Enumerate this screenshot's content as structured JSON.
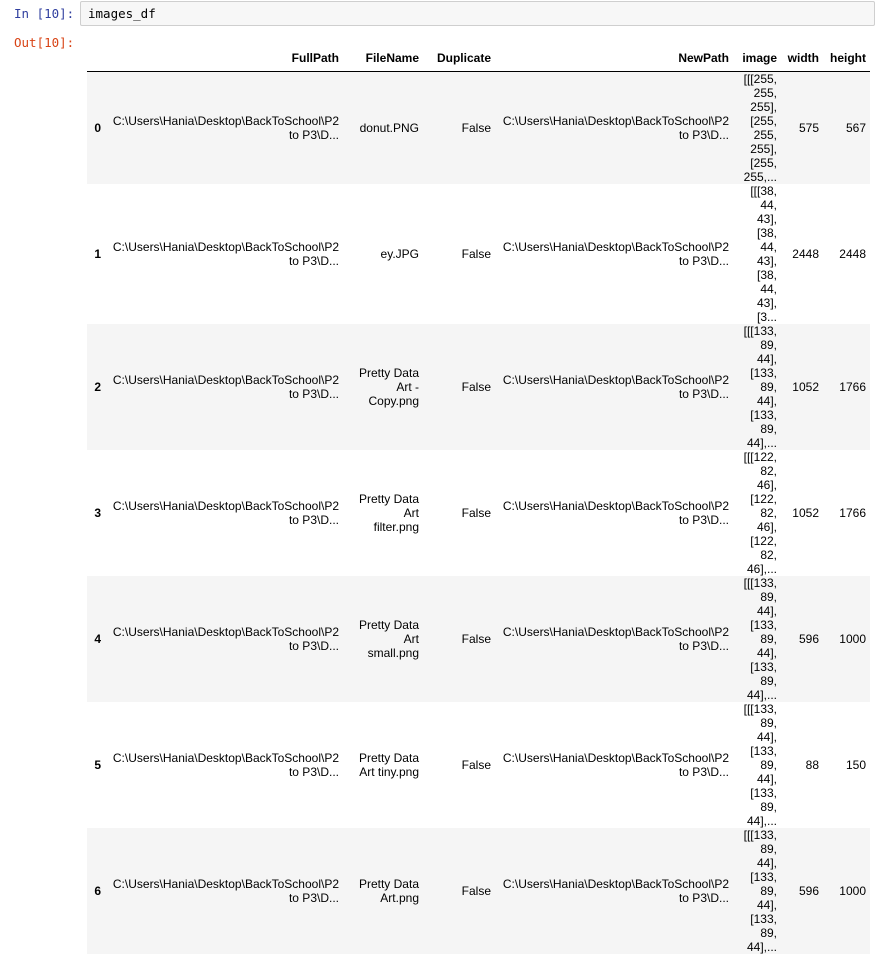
{
  "input_cell": {
    "prompt": "In [10]:",
    "code": "images_df"
  },
  "output_cell": {
    "prompt": "Out[10]:"
  },
  "dataframe": {
    "columns": [
      "",
      "FullPath",
      "FileName",
      "Duplicate",
      "NewPath",
      "image",
      "width",
      "height"
    ],
    "rows": [
      {
        "index": "0",
        "full_path": [
          "C:\\Users\\Hania\\Desktop\\BackToSchool\\P2",
          "to P3\\D..."
        ],
        "file_name": [
          "donut.PNG"
        ],
        "duplicate": "False",
        "new_path": [
          "C:\\Users\\Hania\\Desktop\\BackToSchool\\P2",
          "to P3\\D..."
        ],
        "image": [
          "[[[255,",
          "255,",
          "255],",
          "[255,",
          "255,",
          "255],",
          "[255,",
          "255,..."
        ],
        "width": "575",
        "height": "567"
      },
      {
        "index": "1",
        "full_path": [
          "C:\\Users\\Hania\\Desktop\\BackToSchool\\P2",
          "to P3\\D..."
        ],
        "file_name": [
          "ey.JPG"
        ],
        "duplicate": "False",
        "new_path": [
          "C:\\Users\\Hania\\Desktop\\BackToSchool\\P2",
          "to P3\\D..."
        ],
        "image": [
          "[[[38,",
          "44, 43],",
          "[38, 44,",
          "43],",
          "[38, 44,",
          "43],",
          "[3..."
        ],
        "width": "2448",
        "height": "2448"
      },
      {
        "index": "2",
        "full_path": [
          "C:\\Users\\Hania\\Desktop\\BackToSchool\\P2",
          "to P3\\D..."
        ],
        "file_name": [
          "Pretty Data",
          "Art -",
          "Copy.png"
        ],
        "duplicate": "False",
        "new_path": [
          "C:\\Users\\Hania\\Desktop\\BackToSchool\\P2",
          "to P3\\D..."
        ],
        "image": [
          "[[[133,",
          "89, 44],",
          "[133,",
          "89, 44],",
          "[133,",
          "89,",
          "44],..."
        ],
        "width": "1052",
        "height": "1766"
      },
      {
        "index": "3",
        "full_path": [
          "C:\\Users\\Hania\\Desktop\\BackToSchool\\P2",
          "to P3\\D..."
        ],
        "file_name": [
          "Pretty Data",
          "Art",
          "filter.png"
        ],
        "duplicate": "False",
        "new_path": [
          "C:\\Users\\Hania\\Desktop\\BackToSchool\\P2",
          "to P3\\D..."
        ],
        "image": [
          "[[[122,",
          "82, 46],",
          "[122,",
          "82, 46],",
          "[122,",
          "82,",
          "46],..."
        ],
        "width": "1052",
        "height": "1766"
      },
      {
        "index": "4",
        "full_path": [
          "C:\\Users\\Hania\\Desktop\\BackToSchool\\P2",
          "to P3\\D..."
        ],
        "file_name": [
          "Pretty Data",
          "Art",
          "small.png"
        ],
        "duplicate": "False",
        "new_path": [
          "C:\\Users\\Hania\\Desktop\\BackToSchool\\P2",
          "to P3\\D..."
        ],
        "image": [
          "[[[133,",
          "89, 44],",
          "[133,",
          "89, 44],",
          "[133,",
          "89,",
          "44],..."
        ],
        "width": "596",
        "height": "1000"
      },
      {
        "index": "5",
        "full_path": [
          "C:\\Users\\Hania\\Desktop\\BackToSchool\\P2",
          "to P3\\D..."
        ],
        "file_name": [
          "Pretty Data",
          "Art tiny.png"
        ],
        "duplicate": "False",
        "new_path": [
          "C:\\Users\\Hania\\Desktop\\BackToSchool\\P2",
          "to P3\\D..."
        ],
        "image": [
          "[[[133,",
          "89, 44],",
          "[133,",
          "89, 44],",
          "[133,",
          "89,",
          "44],..."
        ],
        "width": "88",
        "height": "150"
      },
      {
        "index": "6",
        "full_path": [
          "C:\\Users\\Hania\\Desktop\\BackToSchool\\P2",
          "to P3\\D..."
        ],
        "file_name": [
          "Pretty Data",
          "Art.png"
        ],
        "duplicate": "False",
        "new_path": [
          "C:\\Users\\Hania\\Desktop\\BackToSchool\\P2",
          "to P3\\D..."
        ],
        "image": [
          "[[[133,",
          "89, 44],",
          "[133,",
          "89, 44],",
          "[133,",
          "89,",
          "44],..."
        ],
        "width": "596",
        "height": "1000"
      }
    ]
  }
}
